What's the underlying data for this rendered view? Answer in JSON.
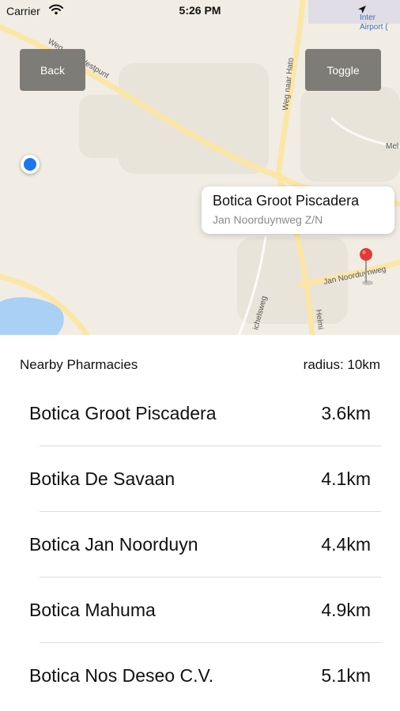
{
  "status_bar": {
    "carrier": "Carrier",
    "time": "5:26 PM"
  },
  "map": {
    "back_label": "Back",
    "toggle_label": "Toggle",
    "street_labels": [
      "Weg naar Westpunt",
      "Weg naar Hato",
      "Jan Noorduynweg",
      "Inter",
      "Airport (",
      "Mel",
      "Helmi",
      "ichelsweg"
    ],
    "callout": {
      "title": "Botica Groot Piscadera",
      "subtitle": "Jan Noorduynweg Z/N"
    },
    "colors": {
      "land": "#f1ede4",
      "water": "#a9d0f5",
      "road": "#fbe6a6",
      "button": "#7e7c77",
      "user_location": "#1b76f2",
      "pin": "#e53935"
    }
  },
  "list": {
    "title": "Nearby Pharmacies",
    "radius": "radius: 10km",
    "items": [
      {
        "name": "Botica Groot Piscadera",
        "distance": "3.6km"
      },
      {
        "name": "Botika De Savaan",
        "distance": "4.1km"
      },
      {
        "name": "Botica Jan Noorduyn",
        "distance": "4.4km"
      },
      {
        "name": "Botica Mahuma",
        "distance": "4.9km"
      },
      {
        "name": "Botica Nos Deseo C.V.",
        "distance": "5.1km"
      }
    ]
  }
}
